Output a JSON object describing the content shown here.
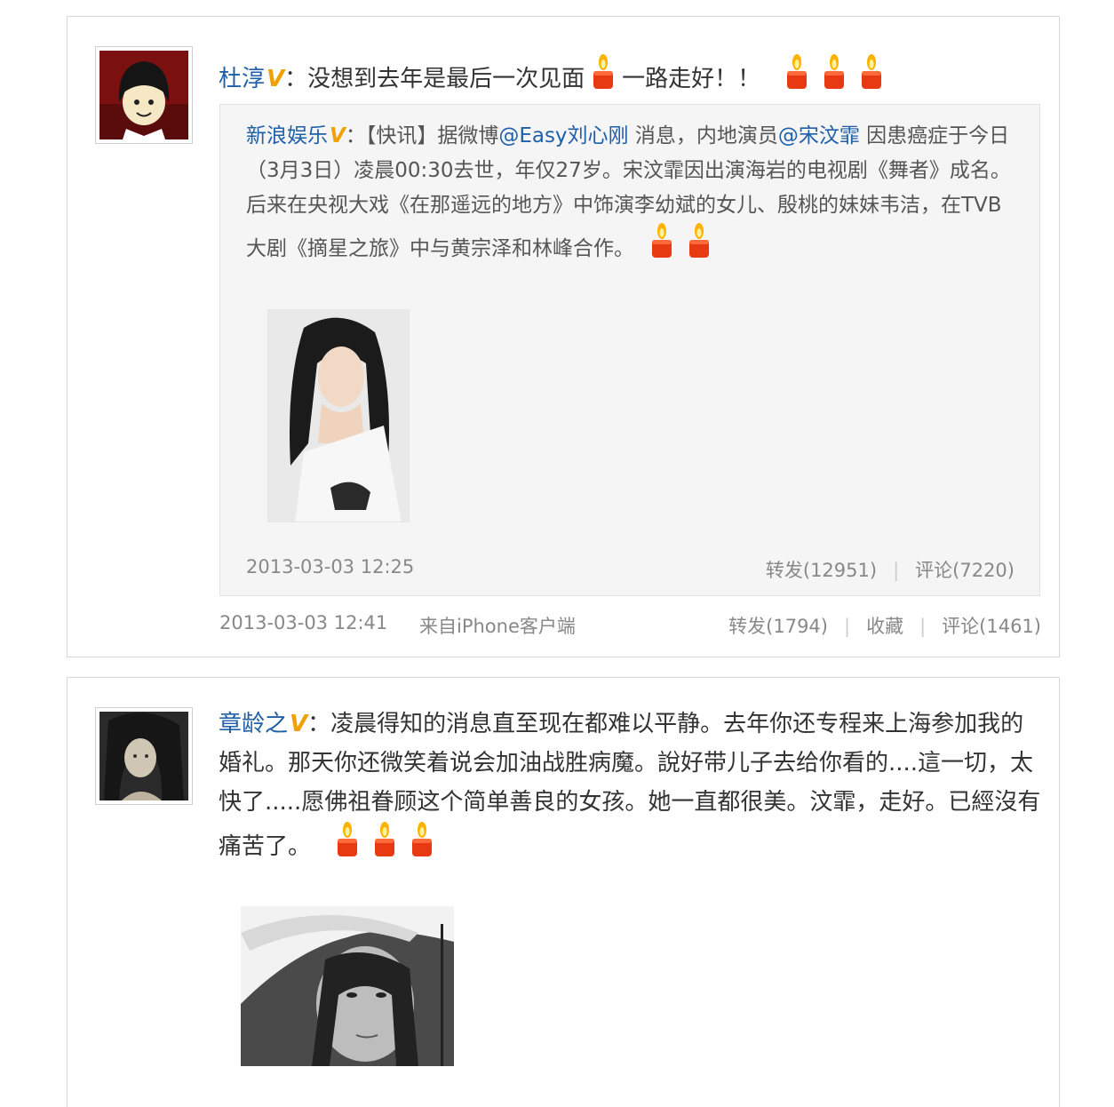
{
  "posts": [
    {
      "avatar": "avatar-cartoon-girl",
      "user": "杜淳",
      "text": "：没想到去年是最后一次见面",
      "text_after": "一路走好！！",
      "quoted": {
        "user": "新浪娱乐",
        "line1_a": "：【快讯】据微博",
        "mention1": "@Easy刘心刚",
        "line1_b": " 消息，内地演员",
        "mention2": "@宋汶霏",
        "line1_c": " 因患癌症于今日（3月3日）凌晨00:30去世，年仅27岁。宋汶霏因出演海岩的电视剧《舞者》成名。后来在央视大戏《在那遥远的地方》中饰演李幼斌的女儿、殷桃的妹妹韦洁，在TVB大剧《摘星之旅》中与黄宗泽和林峰合作。",
        "time": "2013-03-03 12:25",
        "repost": "转发(12951)",
        "comment": "评论(7220)"
      },
      "time": "2013-03-03 12:41",
      "source": "来自iPhone客户端",
      "repost": "转发(1794)",
      "favorite": "收藏",
      "comment": "评论(1461)"
    },
    {
      "avatar": "avatar-woman-photo",
      "user": "章龄之",
      "text": "：凌晨得知的消息直至现在都难以平静。去年你还专程来上海参加我的婚礼。那天你还微笑着说会加油战胜病魔。說好带儿子去给你看的....這一切，太快了.....愿佛祖眷顾这个简单善良的女孩。她一直都很美。汶霏，走好。已經沒有痛苦了。"
    }
  ],
  "icons": {
    "candle": "candle-icon",
    "verified": "verified-v-badge"
  },
  "colors": {
    "link": "#1f5fa8",
    "badge": "#f0a000",
    "meta": "#888888",
    "quoted_bg": "#f5f5f5"
  }
}
